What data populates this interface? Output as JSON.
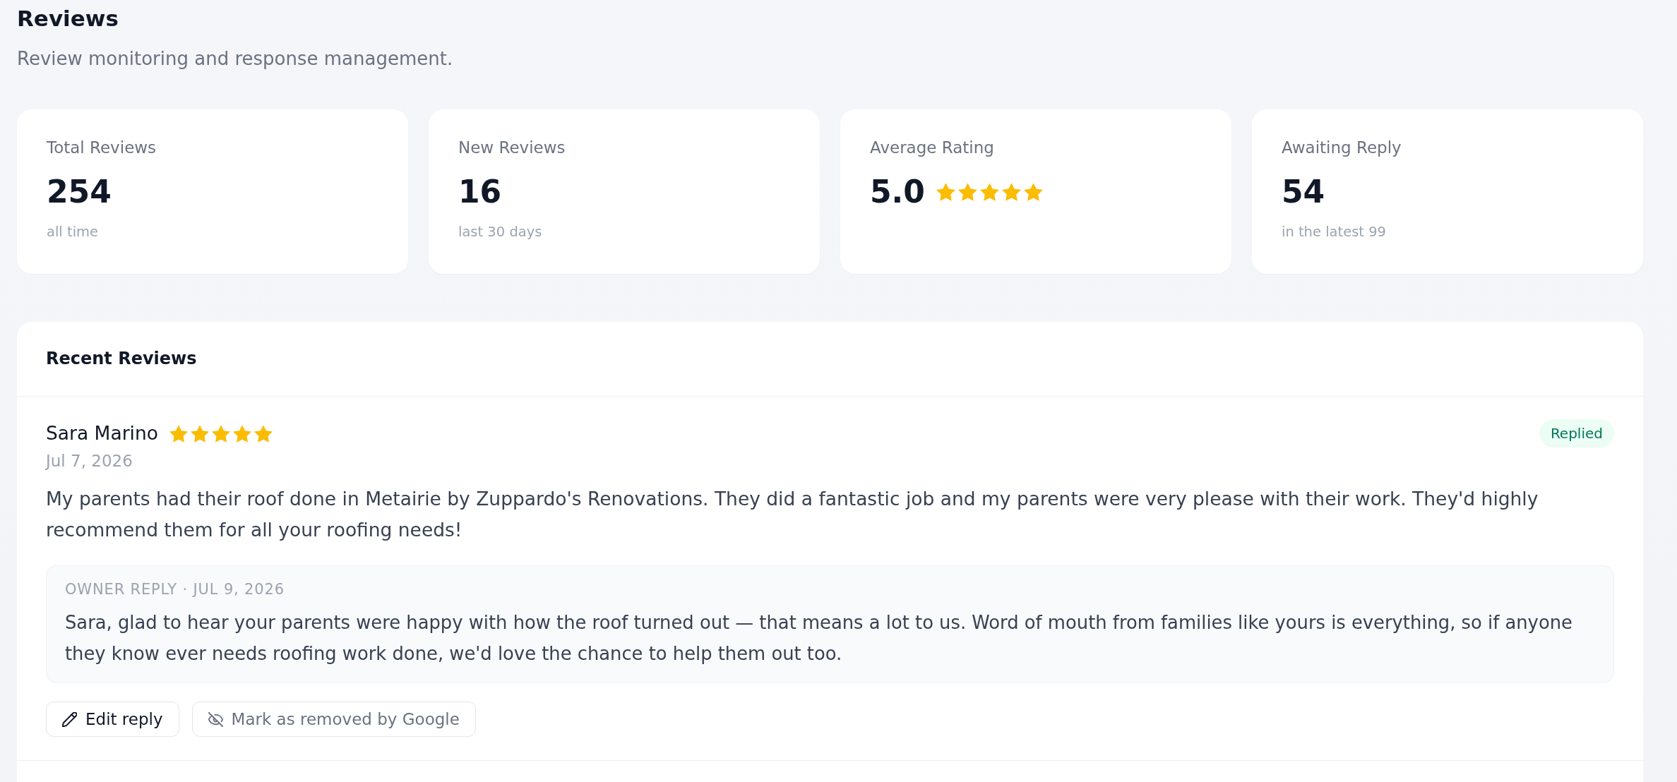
{
  "header": {
    "title": "Reviews",
    "subtitle": "Review monitoring and response management."
  },
  "stats": [
    {
      "label": "Total Reviews",
      "value": "254",
      "note": "all time"
    },
    {
      "label": "New Reviews",
      "value": "16",
      "note": "last 30 days"
    },
    {
      "label": "Average Rating",
      "value": "5.0",
      "stars": 5
    },
    {
      "label": "Awaiting Reply",
      "value": "54",
      "note": "in the latest 99"
    }
  ],
  "recent_reviews": {
    "title": "Recent Reviews",
    "items": [
      {
        "author": "Sara Marino",
        "stars": 5,
        "date": "Jul 7, 2026",
        "status": {
          "label": "Replied",
          "kind": "replied"
        },
        "text": "My parents had their roof done in Metairie by Zuppardo's Renovations. They did a fantastic job and my parents were very please with their work. They'd highly recommend them for all your roofing needs!",
        "reply": {
          "meta": "OWNER REPLY · JUL 9, 2026",
          "text": "Sara, glad to hear your parents were happy with how the roof turned out — that means a lot to us. Word of mouth from families like yours is everything, so if anyone they know ever needs roofing work done, we'd love the chance to help them out too."
        },
        "actions": [
          {
            "label": "Edit reply",
            "kind": "edit"
          },
          {
            "label": "Mark as removed by Google",
            "kind": "remove"
          }
        ]
      }
    ]
  }
}
